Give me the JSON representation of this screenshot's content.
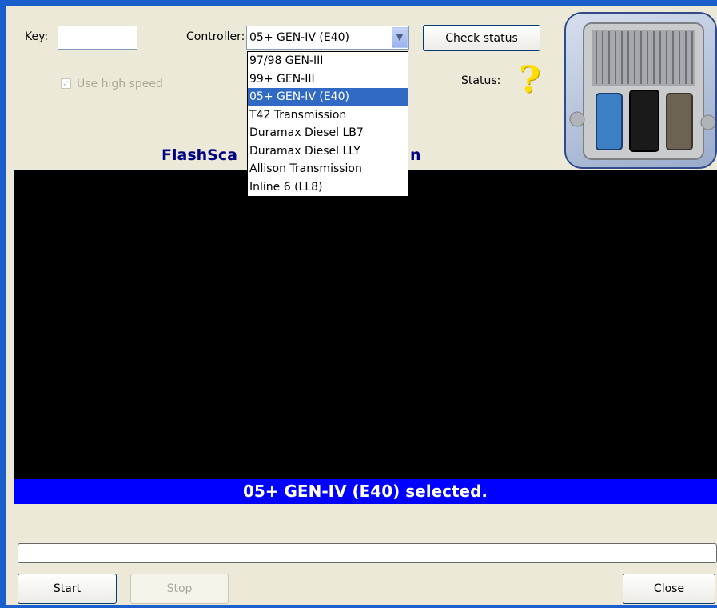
{
  "form": {
    "key_label": "Key:",
    "key_value": "",
    "controller_label": "Controller:",
    "controller_value": "05+ GEN-IV (E40)",
    "check_status_label": "Check status",
    "use_high_speed_label": "Use high speed",
    "use_high_speed_checked": true,
    "status_label": "Status:",
    "status_icon": "question-mark-icon",
    "status_symbol": "?"
  },
  "title_visible": "FlashSca",
  "title_visible_tail": "n",
  "dropdown": {
    "options": [
      "97/98 GEN-III",
      "99+ GEN-III",
      "05+ GEN-IV (E40)",
      "T42 Transmission",
      "Duramax Diesel LB7",
      "Duramax Diesel LLY",
      "Allison Transmission",
      "Inline 6 (LL8)"
    ],
    "selected_index": 2
  },
  "banner": {
    "message": "05+ GEN-IV (E40) selected."
  },
  "progress": {
    "percent": 0
  },
  "buttons": {
    "start": "Start",
    "stop": "Stop",
    "close": "Close"
  },
  "colors": {
    "banner": "#0000ff",
    "selection": "#316ac5",
    "title": "#000084"
  }
}
